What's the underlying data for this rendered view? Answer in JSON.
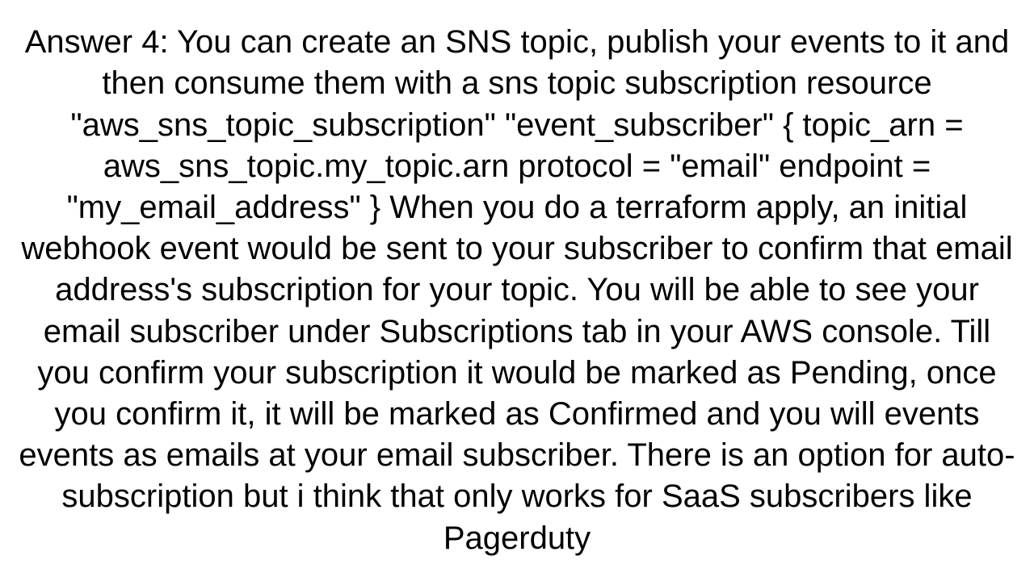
{
  "answer": {
    "text": "Answer 4: You can create an SNS topic, publish your events to it and then consume them with a sns topic subscription resource \"aws_sns_topic_subscription\" \"event_subscriber\" {     topic_arn = aws_sns_topic.my_topic.arn     protocol = \"email\"     endpoint = \"my_email_address\" }  When you do a terraform apply, an initial webhook event would be sent to your subscriber to confirm that email address's subscription for your topic. You will be able to see your email subscriber under Subscriptions tab in your AWS console. Till you confirm your subscription it would be marked as Pending, once you confirm it, it will be marked as Confirmed and you will events events as emails at your email subscriber. There is an option for auto-subscription but i think that only works for SaaS subscribers like Pagerduty"
  }
}
